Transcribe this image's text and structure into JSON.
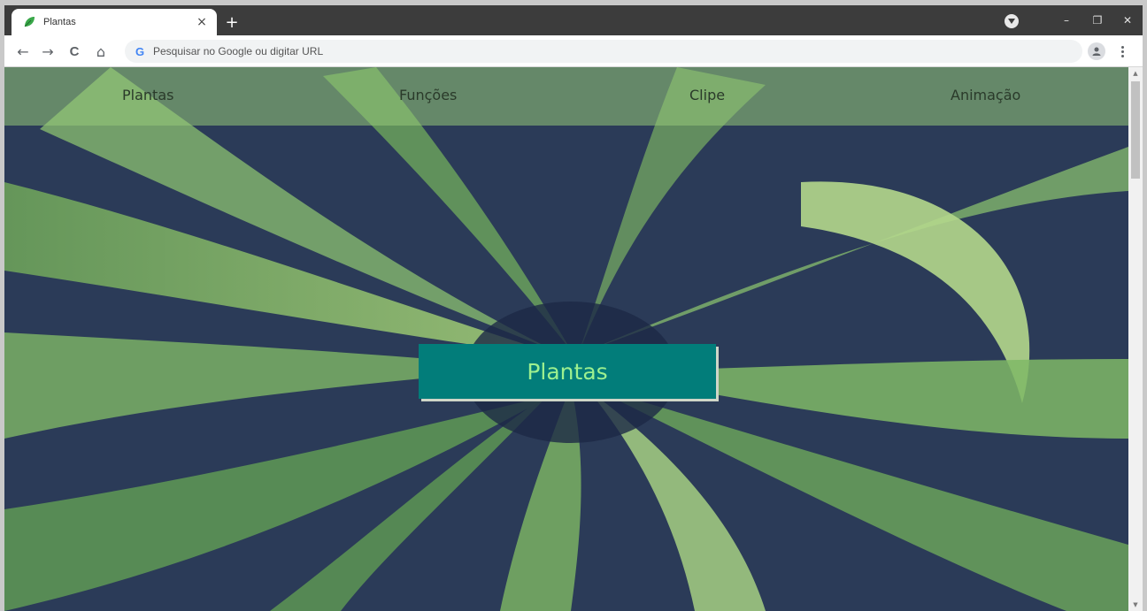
{
  "tab": {
    "title": "Plantas",
    "close_glyph": "×"
  },
  "new_tab_glyph": "+",
  "toolbar": {
    "back_glyph": "←",
    "forward_glyph": "→",
    "reload_glyph": "C",
    "home_glyph": "⌂",
    "omnibox_placeholder": "Pesquisar no Google ou digitar URL",
    "google_glyph": "G"
  },
  "window_controls": {
    "minimize": "–",
    "restore": "❐",
    "close": "✕"
  },
  "nav": [
    "Plantas",
    "Funções",
    "Clipe",
    "Animação"
  ],
  "hero": {
    "title": "Plantas"
  },
  "colors": {
    "nav_band": "#96c878",
    "hero_box": "#027d7a",
    "hero_text": "#9df08f",
    "background": "#283654"
  },
  "icons": [
    "leaf-icon",
    "close-icon",
    "plus-icon",
    "arrow-left-icon",
    "arrow-right-icon",
    "reload-icon",
    "home-icon",
    "google-icon",
    "profile-icon",
    "more-icon",
    "tab-search-icon"
  ]
}
